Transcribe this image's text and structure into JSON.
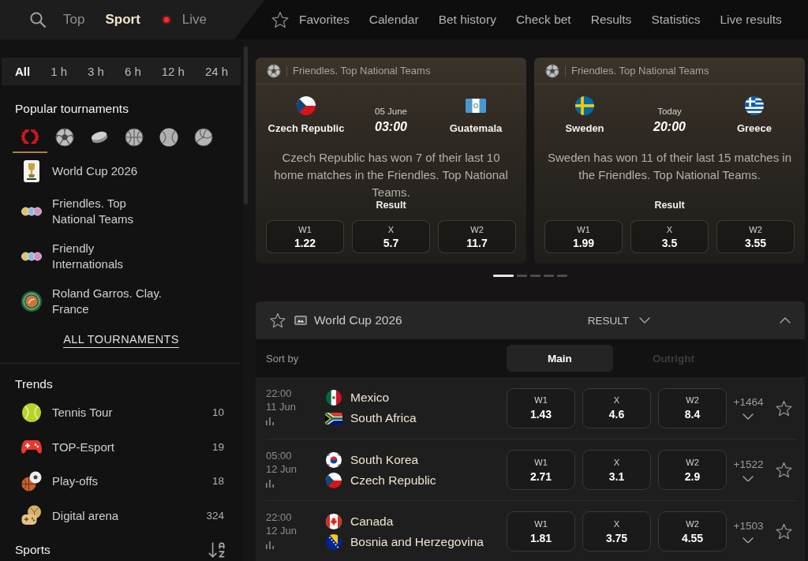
{
  "top_nav": {
    "sections": [
      {
        "kind": "plain",
        "label": "Top",
        "selected": false
      },
      {
        "kind": "plain",
        "label": "Sport",
        "selected": true
      },
      {
        "kind": "live",
        "label": "Live",
        "selected": false
      }
    ],
    "links": [
      {
        "kind": "star",
        "label": "Favorites"
      },
      {
        "kind": "plain",
        "label": "Calendar"
      },
      {
        "kind": "plain",
        "label": "Bet history"
      },
      {
        "kind": "plain",
        "label": "Check bet"
      },
      {
        "kind": "plain",
        "label": "Results"
      },
      {
        "kind": "plain",
        "label": "Statistics"
      },
      {
        "kind": "plain",
        "label": "Live results"
      }
    ]
  },
  "sidebar": {
    "time_filters": [
      {
        "label": "All",
        "selected": true
      },
      {
        "label": "1 h",
        "selected": false
      },
      {
        "label": "3 h",
        "selected": false
      },
      {
        "label": "6 h",
        "selected": false
      },
      {
        "label": "12 h",
        "selected": false
      },
      {
        "label": "24 h",
        "selected": false
      }
    ],
    "popular": {
      "title": "Popular tournaments",
      "sport_filters": [
        {
          "kind": "laurel",
          "selected": true
        },
        {
          "kind": "soccer",
          "selected": false
        },
        {
          "kind": "hockey",
          "selected": false
        },
        {
          "kind": "basketball",
          "selected": false
        },
        {
          "kind": "tennis",
          "selected": false
        },
        {
          "kind": "volleyball",
          "selected": false
        }
      ],
      "tournaments": [
        {
          "kind": "trophy",
          "name": "World Cup 2026"
        },
        {
          "kind": "balls",
          "name": "Friendles. Top National Teams"
        },
        {
          "kind": "balls",
          "name": "Friendly Internationals"
        },
        {
          "kind": "clay",
          "name": "Roland Garros. Clay. France"
        }
      ],
      "all_link": "ALL TOURNAMENTS"
    },
    "trends": {
      "title": "Trends",
      "items": [
        {
          "kind": "tennis",
          "name": "Tennis Tour",
          "count": "10"
        },
        {
          "kind": "gamepad",
          "name": "TOP-Esport",
          "count": "19"
        },
        {
          "kind": "playoffs",
          "name": "Play-offs",
          "count": "18"
        },
        {
          "kind": "arena",
          "name": "Digital arena",
          "count": "324"
        }
      ]
    },
    "sports": {
      "title": "Sports"
    }
  },
  "featured": {
    "cards": [
      {
        "league": "Friendles. Top National Teams",
        "teams": [
          {
            "kind": "czech",
            "name": "Czech Republic"
          },
          {
            "kind": "guatemala",
            "name": "Guatemala"
          }
        ],
        "date": "05 June",
        "time": "03:00",
        "note": "Czech Republic has won 7 of their last 10 home matches in the Friendles. Top National Teams.",
        "market": "Result",
        "odds": [
          {
            "label": "W1",
            "value": "1.22"
          },
          {
            "label": "X",
            "value": "5.7"
          },
          {
            "label": "W2",
            "value": "11.7"
          }
        ]
      },
      {
        "league": "Friendles. Top National Teams",
        "teams": [
          {
            "kind": "sweden",
            "name": "Sweden"
          },
          {
            "kind": "greece",
            "name": "Greece"
          }
        ],
        "date": "Today",
        "time": "20:00",
        "note": "Sweden has won 11 of their last 15 matches in the Friendles. Top National Teams.",
        "market": "Result",
        "odds": [
          {
            "label": "W1",
            "value": "1.99"
          },
          {
            "label": "X",
            "value": "3.5"
          },
          {
            "label": "W2",
            "value": "3.55"
          }
        ]
      }
    ],
    "pager": [
      {
        "selected": true
      },
      {
        "selected": false
      },
      {
        "selected": false
      },
      {
        "selected": false
      },
      {
        "selected": false
      }
    ]
  },
  "section": {
    "title": "World Cup 2026",
    "market": "RESULT",
    "expanded": true,
    "sort_label": "Sort by",
    "sort_tabs": [
      {
        "label": "Main",
        "selected": true
      },
      {
        "label": "Outright",
        "selected": false
      }
    ],
    "matches": [
      {
        "time": "22:00",
        "date": "11 Jun",
        "teams": [
          {
            "kind": "mexico",
            "name": "Mexico"
          },
          {
            "kind": "southafrica",
            "name": "South Africa"
          }
        ],
        "odds": [
          {
            "label": "W1",
            "value": "1.43"
          },
          {
            "label": "X",
            "value": "4.6"
          },
          {
            "label": "W2",
            "value": "8.4"
          }
        ],
        "more": "+1464"
      },
      {
        "time": "05:00",
        "date": "12 Jun",
        "teams": [
          {
            "kind": "korea",
            "name": "South Korea"
          },
          {
            "kind": "czech",
            "name": "Czech Republic"
          }
        ],
        "odds": [
          {
            "label": "W1",
            "value": "2.71"
          },
          {
            "label": "X",
            "value": "3.1"
          },
          {
            "label": "W2",
            "value": "2.9"
          }
        ],
        "more": "+1522"
      },
      {
        "time": "22:00",
        "date": "12 Jun",
        "teams": [
          {
            "kind": "canada",
            "name": "Canada"
          },
          {
            "kind": "bosnia",
            "name": "Bosnia and Herzegovina"
          }
        ],
        "odds": [
          {
            "label": "W1",
            "value": "1.81"
          },
          {
            "label": "X",
            "value": "3.75"
          },
          {
            "label": "W2",
            "value": "4.55"
          }
        ],
        "more": "+1503"
      }
    ]
  }
}
